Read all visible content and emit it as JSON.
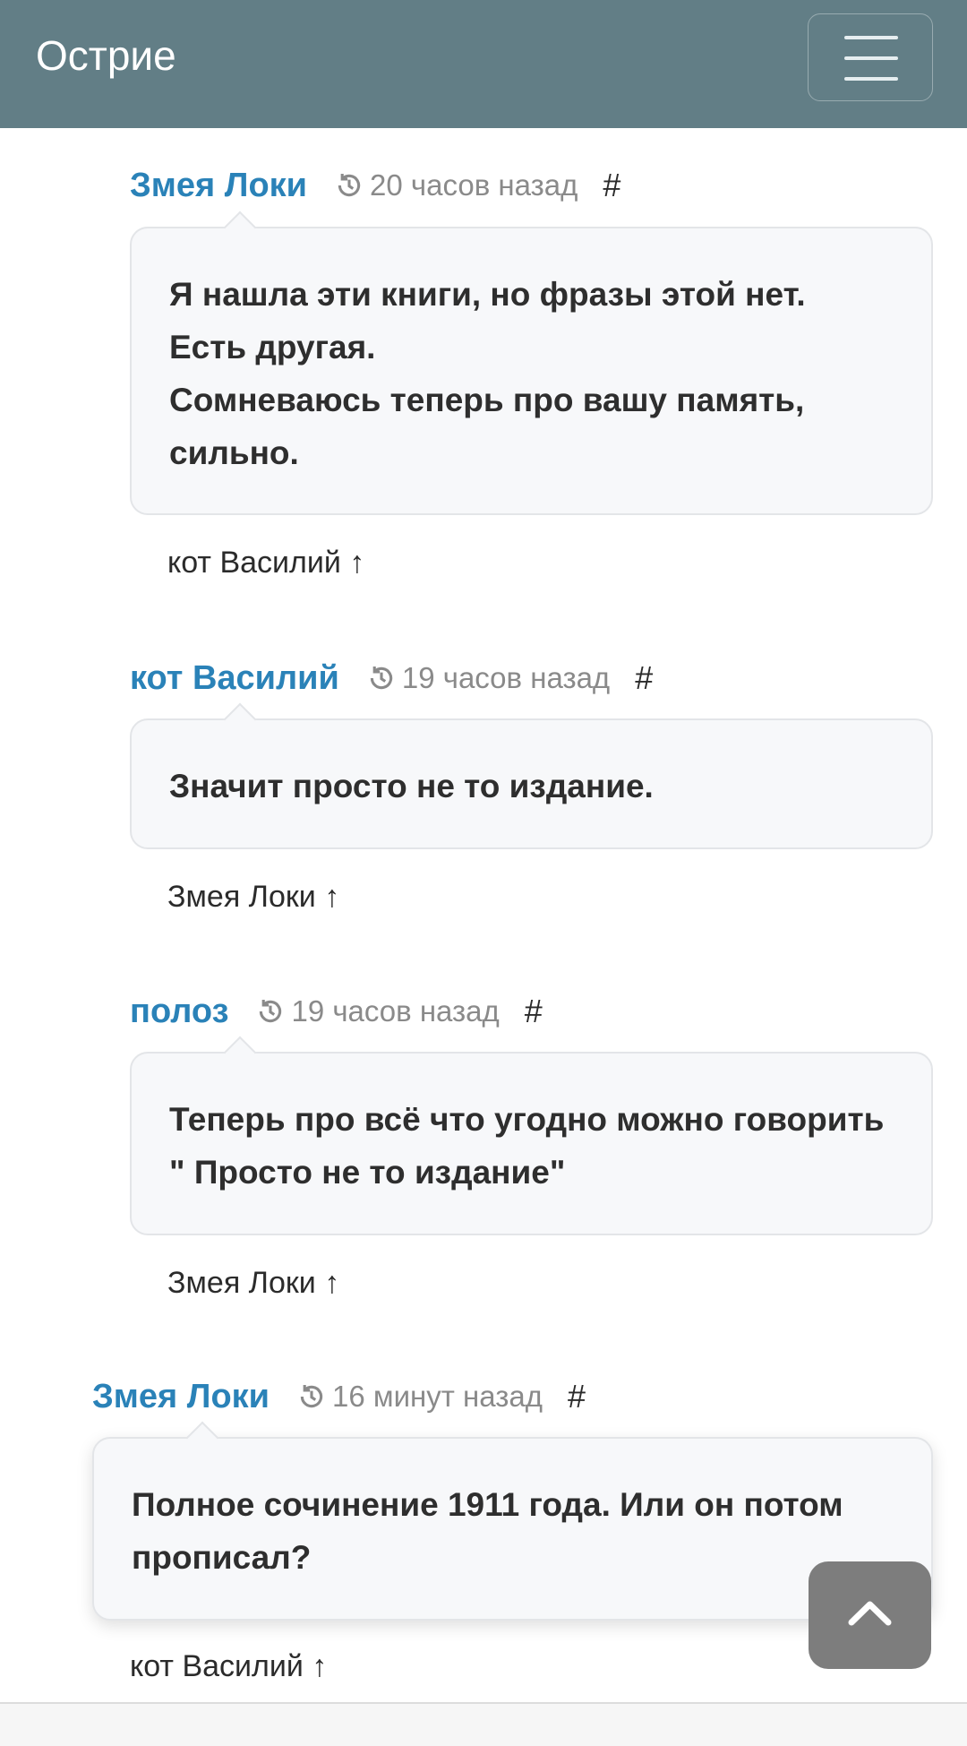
{
  "header": {
    "brand": "Острие",
    "menu_icon": "hamburger-menu-icon"
  },
  "comments": [
    {
      "author": "Змея Локи",
      "time": "20 часов назад",
      "anchor": "#",
      "text": "Я нашла эти книги, но фразы этой нет.\nЕсть другая.\nСомневаюсь теперь про вашу память, сильно.",
      "reply_to": "кот Василий ↑"
    },
    {
      "author": "кот Василий",
      "time": "19 часов назад",
      "anchor": "#",
      "text": "Значит просто не то издание.",
      "reply_to": "Змея Локи ↑"
    },
    {
      "author": "полоз",
      "time": "19 часов назад",
      "anchor": "#",
      "text": "Теперь про всё что угодно можно говорить \" Просто не то издание\"",
      "reply_to": "Змея Локи ↑"
    },
    {
      "author": "Змея Локи",
      "time": "16 минут назад",
      "anchor": "#",
      "text": "Полное сочинение 1911 года. Или он потом прописал?",
      "reply_to": "кот Василий ↑"
    }
  ],
  "scroll_top_icon": "chevron-up-icon",
  "colors": {
    "header": "#627e86",
    "author": "#2a82b8",
    "bubble": "#f7f8fa"
  }
}
